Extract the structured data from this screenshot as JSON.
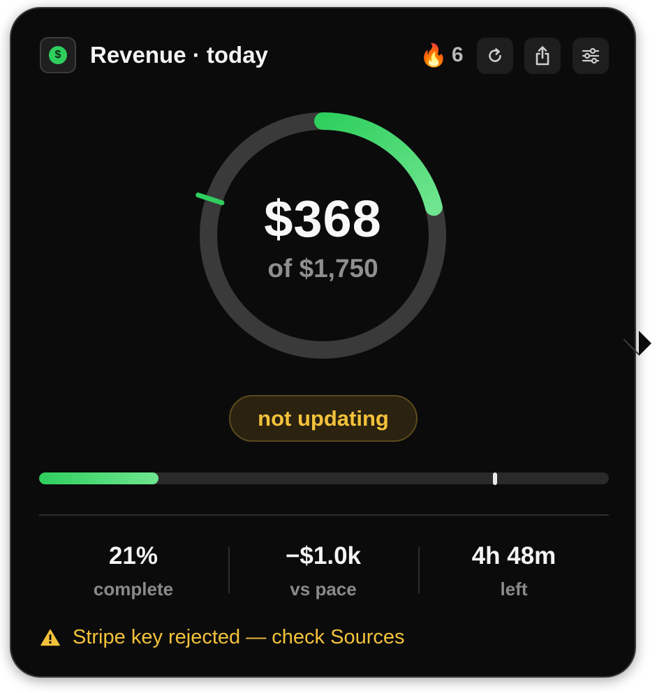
{
  "header": {
    "title": "Revenue · today",
    "app_icon_glyph": "$",
    "streak_emoji": "🔥",
    "streak_count": "6",
    "actions": [
      {
        "icon": "refresh-icon"
      },
      {
        "icon": "share-icon"
      },
      {
        "icon": "sliders-icon"
      }
    ]
  },
  "ring": {
    "value": "$368",
    "goal_text": "of $1,750",
    "progress_fraction": 0.21,
    "pace_fraction": 0.8,
    "track_color": "#3a3a3a",
    "fill_color": "#2fcf5e",
    "fill_color_end": "#6fe58f"
  },
  "status": {
    "label": "not updating",
    "color": "#f3c23b"
  },
  "progress_bar": {
    "fill_fraction": 0.21,
    "pace_fraction": 0.8
  },
  "stats": [
    {
      "value": "21%",
      "label": "complete"
    },
    {
      "value": "−$1.0k",
      "label": "vs pace"
    },
    {
      "value": "4h 48m",
      "label": "left"
    }
  ],
  "warning": {
    "icon": "warning-icon",
    "text": "Stripe key rejected — check Sources"
  }
}
